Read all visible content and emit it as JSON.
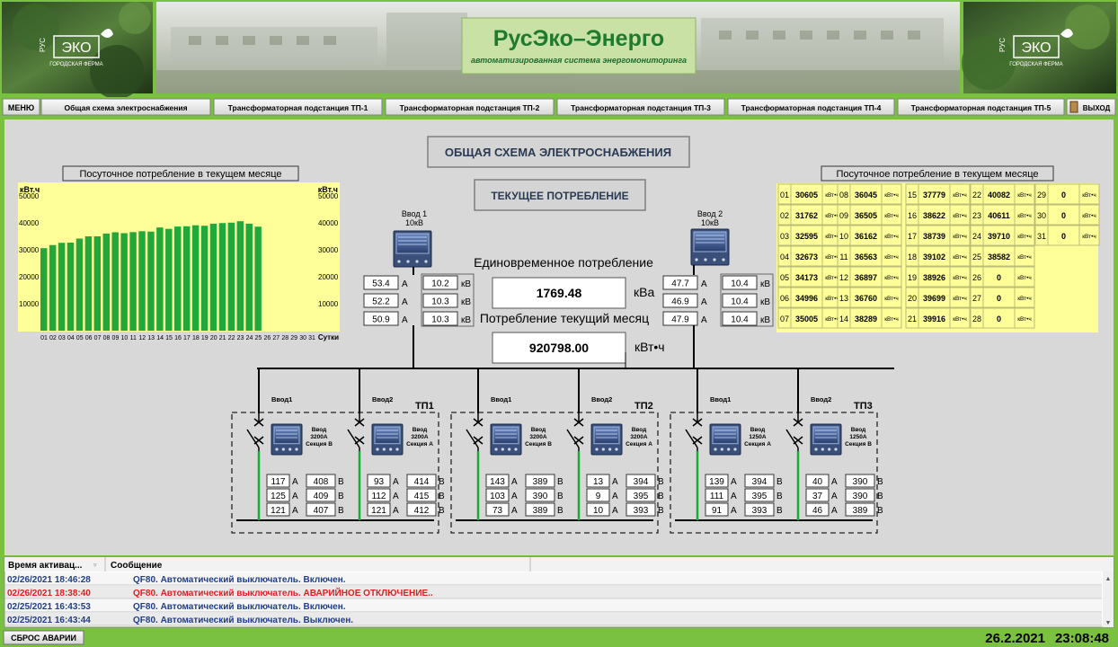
{
  "header": {
    "title": "РусЭко–Энерго",
    "subtitle": "автоматизированная система энергомониторинга",
    "logo_text": "ЭКО",
    "logo_side": "РУС",
    "logo_caption": "ГОРОДСКАЯ ФЕРМА"
  },
  "menu": {
    "menu_label": "МЕНЮ",
    "tabs": [
      "Общая схема электроснабжения",
      "Трансформаторная подстанция ТП-1",
      "Трансформаторная подстанция ТП-2",
      "Трансформаторная подстанция ТП-3",
      "Трансформаторная подстанция ТП-4",
      "Трансформаторная подстанция ТП-5"
    ],
    "exit_label": "ВЫХОД"
  },
  "scheme": {
    "title": "ОБЩАЯ СХЕМА ЭЛЕКТРОСНАБЖЕНИЯ",
    "current_label": "ТЕКУЩЕЕ ПОТРЕБЛЕНИЕ",
    "instant_label": "Единовременное потребление",
    "instant_value": "1769.48",
    "instant_unit": "кВа",
    "month_label": "Потребление текущий месяц",
    "month_value": "920798.00",
    "month_unit": "кВт•ч"
  },
  "input1": {
    "title1": "Ввод 1",
    "title2": "10кВ",
    "amps": [
      "53.4",
      "52.2",
      "50.9"
    ],
    "volts": [
      "10.2",
      "10.3",
      "10.3"
    ]
  },
  "input2": {
    "title1": "Ввод 2",
    "title2": "10кВ",
    "amps": [
      "47.7",
      "46.9",
      "47.9"
    ],
    "volts": [
      "10.4",
      "10.4",
      "10.4"
    ]
  },
  "units": {
    "a": "А",
    "kv": "кВ",
    "v": "В",
    "kwh": "кВт•ч"
  },
  "substations": [
    {
      "name": "ТП1",
      "feeds": [
        {
          "label": "Ввод1",
          "meter1": "Ввод",
          "meter2": "3200А",
          "meter3": "Секция В",
          "amps": [
            "117",
            "125",
            "121"
          ],
          "volts": [
            "408",
            "409",
            "407"
          ]
        },
        {
          "label": "Ввод2",
          "meter1": "Ввод",
          "meter2": "3200А",
          "meter3": "Секция А",
          "amps": [
            "93",
            "112",
            "121"
          ],
          "volts": [
            "414",
            "415",
            "412"
          ]
        }
      ]
    },
    {
      "name": "ТП2",
      "feeds": [
        {
          "label": "Ввод1",
          "meter1": "Ввод",
          "meter2": "3200А",
          "meter3": "Секция В",
          "amps": [
            "143",
            "103",
            "73"
          ],
          "volts": [
            "389",
            "390",
            "389"
          ]
        },
        {
          "label": "Ввод2",
          "meter1": "Ввод",
          "meter2": "3200А",
          "meter3": "Секция А",
          "amps": [
            "13",
            "9",
            "10"
          ],
          "volts": [
            "394",
            "395",
            "393"
          ]
        }
      ]
    },
    {
      "name": "ТП3",
      "feeds": [
        {
          "label": "Ввод1",
          "meter1": "Ввод",
          "meter2": "1250А",
          "meter3": "Секция А",
          "amps": [
            "139",
            "111",
            "91"
          ],
          "volts": [
            "394",
            "395",
            "393"
          ]
        },
        {
          "label": "Ввод2",
          "meter1": "Ввод",
          "meter2": "1250А",
          "meter3": "Секция В",
          "amps": [
            "40",
            "37",
            "46"
          ],
          "volts": [
            "390",
            "390",
            "389"
          ]
        }
      ]
    }
  ],
  "daily_table": {
    "title": "Посуточное потребление в текущем месяце",
    "days": [
      [
        "01",
        "30605"
      ],
      [
        "02",
        "31762"
      ],
      [
        "03",
        "32595"
      ],
      [
        "04",
        "32673"
      ],
      [
        "05",
        "34173"
      ],
      [
        "06",
        "34996"
      ],
      [
        "07",
        "35005"
      ],
      [
        "08",
        "36045"
      ],
      [
        "09",
        "36505"
      ],
      [
        "10",
        "36162"
      ],
      [
        "11",
        "36563"
      ],
      [
        "12",
        "36897"
      ],
      [
        "13",
        "36760"
      ],
      [
        "14",
        "38289"
      ],
      [
        "15",
        "37779"
      ],
      [
        "16",
        "38622"
      ],
      [
        "17",
        "38739"
      ],
      [
        "18",
        "39102"
      ],
      [
        "19",
        "38926"
      ],
      [
        "20",
        "39699"
      ],
      [
        "21",
        "39916"
      ],
      [
        "22",
        "40082"
      ],
      [
        "23",
        "40611"
      ],
      [
        "24",
        "39710"
      ],
      [
        "25",
        "38582"
      ],
      [
        "26",
        "0"
      ],
      [
        "27",
        "0"
      ],
      [
        "28",
        "0"
      ],
      [
        "29",
        "0"
      ],
      [
        "30",
        "0"
      ],
      [
        "31",
        "0"
      ]
    ]
  },
  "chart_data": {
    "type": "bar",
    "title": "Посуточное потребление в текущем месяце",
    "ylabel": "кВт.ч",
    "xlabel": "Сутки",
    "ylim": [
      0,
      55000
    ],
    "yticks": [
      10000,
      20000,
      30000,
      40000,
      50000
    ],
    "color": "#22a83a",
    "categories": [
      "01",
      "02",
      "03",
      "04",
      "05",
      "06",
      "07",
      "08",
      "09",
      "10",
      "11",
      "12",
      "13",
      "14",
      "15",
      "16",
      "17",
      "18",
      "19",
      "20",
      "21",
      "22",
      "23",
      "24",
      "25",
      "26",
      "27",
      "28",
      "29",
      "30",
      "31"
    ],
    "values": [
      30605,
      31762,
      32595,
      32673,
      34173,
      34996,
      35005,
      36045,
      36505,
      36162,
      36563,
      36897,
      36760,
      38289,
      37779,
      38622,
      38739,
      39102,
      38926,
      39699,
      39916,
      40082,
      40611,
      39710,
      38582,
      0,
      0,
      0,
      0,
      0,
      0
    ]
  },
  "events": {
    "col_time": "Время активац...",
    "col_msg": "Сообщение",
    "rows": [
      {
        "time": "02/26/2021 18:46:28",
        "msg": "QF80. Автоматический выключатель. Включен.",
        "alarm": false
      },
      {
        "time": "02/26/2021 18:38:40",
        "msg": "QF80. Автоматический выключатель. АВАРИЙНОЕ ОТКЛЮЧЕНИЕ..",
        "alarm": true
      },
      {
        "time": "02/25/2021 16:43:53",
        "msg": "QF80. Автоматический выключатель. Включен.",
        "alarm": false
      },
      {
        "time": "02/25/2021 16:43:44",
        "msg": "QF80. Автоматический выключатель. Выключен.",
        "alarm": false
      }
    ]
  },
  "footer": {
    "reset_label": "СБРОС АВАРИИ",
    "date": "26.2.2021",
    "time": "23:08:48"
  },
  "colors": {
    "frame": "#7ac142",
    "panel": "#d8d8d8",
    "chart_bg": "#ffff99",
    "bar": "#22a83a",
    "blue_text": "#1f3d8a",
    "alarm_text": "#e02020"
  }
}
